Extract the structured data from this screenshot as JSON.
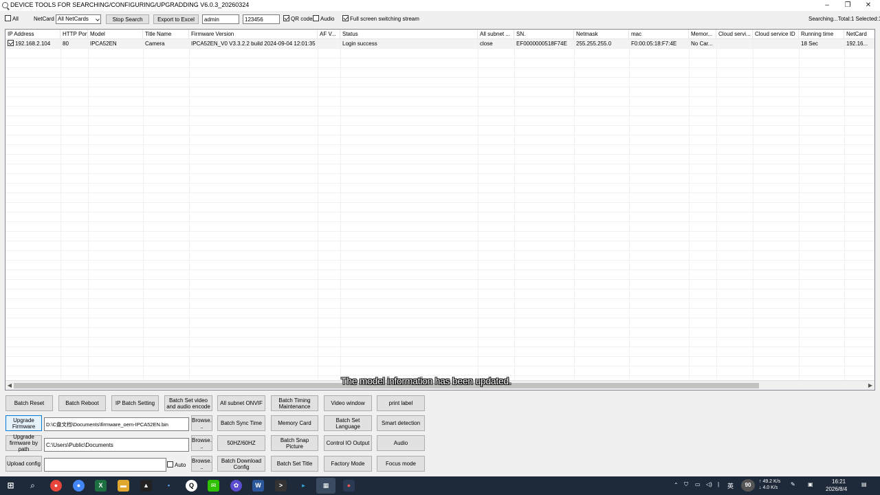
{
  "window": {
    "title": "DEVICE TOOLS FOR SEARCHING/CONFIGURING/UPGRADDING V6.0.3_20260324",
    "minimize": "–",
    "restore": "❐",
    "close": "✕"
  },
  "toolbar": {
    "all_label": "All",
    "netcard_label": "NetCard",
    "netcard_value": "All NetCards",
    "stop_search": "Stop Search",
    "export_excel": "Export to Excel",
    "username": "admin",
    "password": "123456",
    "qr_code_label": "QR code",
    "qr_code_checked": true,
    "audio_label": "Audio",
    "audio_checked": false,
    "fullscreen_label": "Full screen switching stream",
    "fullscreen_checked": true,
    "summary": "Searching...Total:1 Selected:1"
  },
  "table": {
    "columns": [
      "IP Address",
      "HTTP Port",
      "Model",
      "Title Name",
      "Firmware Version",
      "AF V...",
      "Status",
      "All subnet ...",
      "SN.",
      "Netmask",
      "mac",
      "Memor...",
      "Cloud servi...",
      "Cloud service ID",
      "Running time",
      "NetCard"
    ],
    "rows": [
      {
        "checked": true,
        "cells": [
          "192.168.2.104",
          "80",
          "IPCA52EN",
          "Camera",
          "IPCA52EN_V0 V3.3.2.2 build 2024-09-04 12:01:35",
          "",
          "Login success",
          "close",
          "EF0000000518F74E",
          "255.255.255.0",
          "F0:00:05:18:F7:4E",
          "No Car...",
          "",
          "",
          "18 Sec",
          "192.16..."
        ]
      }
    ]
  },
  "status_message": "The model information has been updated.",
  "buttons": {
    "batch_reset": "Batch Reset",
    "batch_reboot": "Batch Reboot",
    "ip_batch_setting": "IP Batch Setting",
    "batch_set_video": "Batch Set video and audio encode",
    "all_subnet_onvif": "All subnet ONVIF",
    "batch_timing": "Batch Timing Maintenance",
    "video_window": "Video window",
    "print_label": "print label",
    "upgrade_firmware": "Upgrade Firmware",
    "browse": "Browse. ..",
    "batch_sync_time": "Batch Sync Time",
    "memory_card": "Memory Card",
    "batch_set_language": "Batch Set Language",
    "smart_detection": "Smart detection",
    "upgrade_by_path": "Upgrade firmware by path",
    "hz": "50HZ/60HZ",
    "batch_snap": "Batch Snap Picture",
    "control_io": "Control IO Output",
    "audio": "Audio",
    "upload_config": "Upload config",
    "auto_label": "Auto",
    "batch_download_config": "Batch Download Config",
    "batch_set_title": "Batch Set Title",
    "factory_mode": "Factory Mode",
    "focus_mode": "Focus mode"
  },
  "paths": {
    "firmware_path": "D:\\C盘文档\\Documents\\firmware_oem-IPCA52EN.bin",
    "folder_path": "C:\\Users\\Public\\Documents",
    "config_path": ""
  },
  "taskbar": {
    "icons": [
      "windows-icon",
      "search-icon",
      "chrome-icon",
      "chrome-icon",
      "excel-icon",
      "folder-icon",
      "app-icon",
      "app-icon",
      "qq-icon",
      "wechat-icon",
      "app-icon",
      "word-icon",
      "terminal-icon",
      "app-icon",
      "device-tools-icon",
      "app-icon"
    ],
    "lang": "英",
    "battery": "90",
    "net_up": "↑ 49.2 K/s",
    "net_down": "↓ 4.0 K/s",
    "time": "16:21",
    "date": "2026/8/4"
  },
  "colors": {
    "taskbar": "#1e2a3a",
    "active_button_border": "#0078d7"
  }
}
